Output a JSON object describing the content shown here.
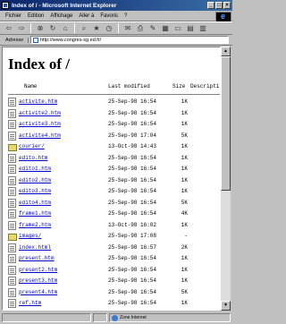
{
  "window": {
    "title": "Index of / - Microsoft Internet Explorer",
    "min": "_",
    "max": "□",
    "close": "×"
  },
  "menu": [
    "Fichier",
    "Edition",
    "Affichage",
    "Aller à",
    "Favoris",
    "?"
  ],
  "address": {
    "label": "Adresse",
    "url": "http://www.congres-sg.ed.fr/"
  },
  "page": {
    "title": "Index of /",
    "columns": {
      "name": "Name",
      "modified": "Last modified",
      "size": "Size",
      "desc": "Descripti"
    }
  },
  "files": [
    {
      "icon": "file",
      "name": "activite.htm",
      "date": "25-Sep-98 16:54",
      "size": "1K"
    },
    {
      "icon": "file",
      "name": "activite2.htm",
      "date": "25-Sep-98 16:54",
      "size": "1K"
    },
    {
      "icon": "file",
      "name": "activite3.htm",
      "date": "25-Sep-98 16:54",
      "size": "1K"
    },
    {
      "icon": "file",
      "name": "activite4.htm",
      "date": "25-Sep-98 17:04",
      "size": "5K"
    },
    {
      "icon": "folder",
      "name": "courier/",
      "date": "13-Oct-98 14:43",
      "size": "1K"
    },
    {
      "icon": "file",
      "name": "edito.htm",
      "date": "25-Sep-98 16:54",
      "size": "1K"
    },
    {
      "icon": "file",
      "name": "edito1.htm",
      "date": "25-Sep-98 16:54",
      "size": "1K"
    },
    {
      "icon": "file",
      "name": "edito2.htm",
      "date": "25-Sep-98 16:54",
      "size": "1K"
    },
    {
      "icon": "file",
      "name": "edito3.htm",
      "date": "25-Sep-98 16:54",
      "size": "1K"
    },
    {
      "icon": "file",
      "name": "edito4.htm",
      "date": "25-Sep-98 16:54",
      "size": "5K"
    },
    {
      "icon": "file",
      "name": "frame1.htm",
      "date": "25-Sep-98 16:54",
      "size": "4K"
    },
    {
      "icon": "file",
      "name": "frame2.htm",
      "date": "13-Oct-98 16:02",
      "size": "1K"
    },
    {
      "icon": "folder",
      "name": "images/",
      "date": "25-Sep-98 17:08",
      "size": "-"
    },
    {
      "icon": "file",
      "name": "index.html",
      "date": "25-Sep-98 16:57",
      "size": "2K"
    },
    {
      "icon": "file",
      "name": "present.htm",
      "date": "25-Sep-98 16:54",
      "size": "1K"
    },
    {
      "icon": "file",
      "name": "present2.htm",
      "date": "25-Sep-98 16:54",
      "size": "1K"
    },
    {
      "icon": "file",
      "name": "present3.htm",
      "date": "25-Sep-98 16:54",
      "size": "1K"
    },
    {
      "icon": "file",
      "name": "present4.htm",
      "date": "25-Sep-98 16:54",
      "size": "5K"
    },
    {
      "icon": "file",
      "name": "ref.htm",
      "date": "25-Sep-98 16:54",
      "size": "1K"
    }
  ],
  "status": {
    "zone": "Zone Internet"
  }
}
